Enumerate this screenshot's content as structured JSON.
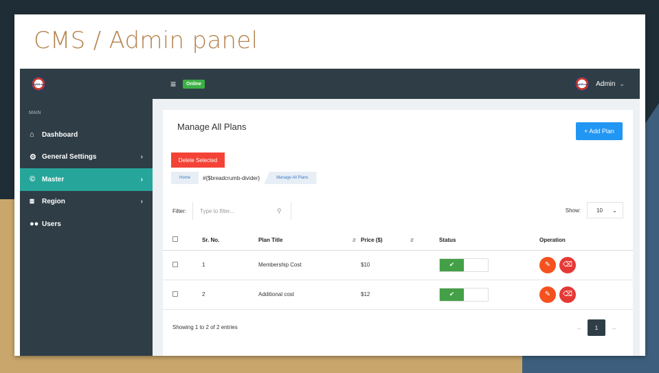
{
  "slide": {
    "title": "CMS / Admin panel"
  },
  "topbar": {
    "logo_text": "TripWLane",
    "menu_icon": "hamburger-icon",
    "status_badge": "Online",
    "user_name": "Admin"
  },
  "sidebar": {
    "section_label": "MAIN",
    "items": [
      {
        "label": "Dashboard",
        "icon": "home-icon",
        "has_arrow": false
      },
      {
        "label": "General Settings",
        "icon": "gear-icon",
        "has_arrow": true
      },
      {
        "label": "Master",
        "icon": "copyright-icon",
        "has_arrow": true,
        "active": true
      },
      {
        "label": "Region",
        "icon": "satellite-icon",
        "has_arrow": true
      },
      {
        "label": "Users",
        "icon": "users-icon",
        "has_arrow": false
      }
    ]
  },
  "main": {
    "heading": "Manage All Plans",
    "add_button": "+ Add Plan",
    "delete_button": "Delete Selected",
    "breadcrumb": {
      "home": "Home",
      "divider": "#{$breadcrumb-divider}",
      "current": "Manage All Plans"
    },
    "filter": {
      "label": "Filter:",
      "placeholder": "Type to filter..."
    },
    "show": {
      "label": "Show:",
      "value": "10"
    },
    "table": {
      "headers": [
        "Sr. No.",
        "Plan Title",
        "Price ($)",
        "Status",
        "Operation"
      ],
      "rows": [
        {
          "sr": "1",
          "title": "Membership Cost",
          "price": "$10",
          "status": true
        },
        {
          "sr": "2",
          "title": "Additional cost",
          "price": "$12",
          "status": true
        }
      ]
    },
    "footer": {
      "info": "Showing 1 to 2 of 2 entries",
      "prev": "←",
      "page": "1",
      "next": "→"
    }
  },
  "colors": {
    "sidebar_bg": "#2f3e46",
    "active_item": "#26a69a",
    "primary_button": "#2196f3",
    "danger_button": "#f44336",
    "toggle_on": "#43a047",
    "title_color": "#b5824d"
  }
}
